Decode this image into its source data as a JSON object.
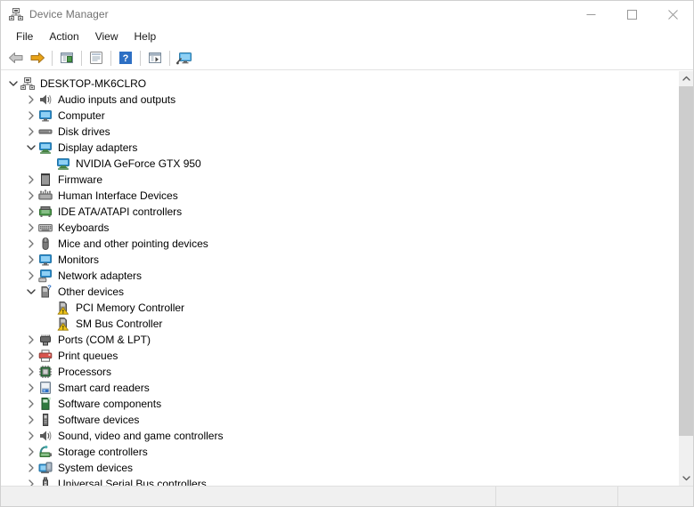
{
  "window": {
    "title": "Device Manager",
    "title_icon": "device-manager-icon",
    "controls": {
      "minimize": "Minimize",
      "maximize": "Maximize",
      "close": "Close"
    }
  },
  "menubar": {
    "items": [
      {
        "label": "File",
        "name": "menu-file"
      },
      {
        "label": "Action",
        "name": "menu-action"
      },
      {
        "label": "View",
        "name": "menu-view"
      },
      {
        "label": "Help",
        "name": "menu-help"
      }
    ]
  },
  "toolbar": {
    "buttons": [
      {
        "icon": "back-arrow-icon",
        "name": "toolbar-back"
      },
      {
        "icon": "forward-arrow-icon",
        "name": "toolbar-forward"
      },
      {
        "icon": "properties-icon",
        "name": "toolbar-properties"
      },
      {
        "icon": "update-driver-icon",
        "name": "toolbar-update-driver"
      },
      {
        "icon": "help-icon",
        "name": "toolbar-help"
      },
      {
        "icon": "scan-hardware-icon",
        "name": "toolbar-scan-hardware"
      },
      {
        "icon": "show-hidden-devices-icon",
        "name": "toolbar-show-hidden"
      }
    ]
  },
  "tree": {
    "nodes": [
      {
        "label": "DESKTOP-MK6CLRO",
        "depth": 0,
        "state": "expanded",
        "icon": "computer-node-icon"
      },
      {
        "label": "Audio inputs and outputs",
        "depth": 1,
        "state": "collapsed",
        "icon": "speaker-icon"
      },
      {
        "label": "Computer",
        "depth": 1,
        "state": "collapsed",
        "icon": "monitor-icon"
      },
      {
        "label": "Disk drives",
        "depth": 1,
        "state": "collapsed",
        "icon": "disk-drive-icon"
      },
      {
        "label": "Display adapters",
        "depth": 1,
        "state": "expanded",
        "icon": "display-adapter-icon"
      },
      {
        "label": "NVIDIA GeForce GTX 950",
        "depth": 2,
        "state": "leaf",
        "icon": "display-adapter-icon"
      },
      {
        "label": "Firmware",
        "depth": 1,
        "state": "collapsed",
        "icon": "firmware-icon"
      },
      {
        "label": "Human Interface Devices",
        "depth": 1,
        "state": "collapsed",
        "icon": "hid-icon"
      },
      {
        "label": "IDE ATA/ATAPI controllers",
        "depth": 1,
        "state": "collapsed",
        "icon": "ide-controller-icon"
      },
      {
        "label": "Keyboards",
        "depth": 1,
        "state": "collapsed",
        "icon": "keyboard-icon"
      },
      {
        "label": "Mice and other pointing devices",
        "depth": 1,
        "state": "collapsed",
        "icon": "mouse-icon"
      },
      {
        "label": "Monitors",
        "depth": 1,
        "state": "collapsed",
        "icon": "monitor-icon"
      },
      {
        "label": "Network adapters",
        "depth": 1,
        "state": "collapsed",
        "icon": "network-adapter-icon"
      },
      {
        "label": "Other devices",
        "depth": 1,
        "state": "expanded",
        "icon": "unknown-device-icon"
      },
      {
        "label": "PCI Memory Controller",
        "depth": 2,
        "state": "leaf",
        "icon": "unknown-device-warning-icon"
      },
      {
        "label": "SM Bus Controller",
        "depth": 2,
        "state": "leaf",
        "icon": "unknown-device-warning-icon"
      },
      {
        "label": "Ports (COM & LPT)",
        "depth": 1,
        "state": "collapsed",
        "icon": "port-icon"
      },
      {
        "label": "Print queues",
        "depth": 1,
        "state": "collapsed",
        "icon": "printer-icon"
      },
      {
        "label": "Processors",
        "depth": 1,
        "state": "collapsed",
        "icon": "processor-icon"
      },
      {
        "label": "Smart card readers",
        "depth": 1,
        "state": "collapsed",
        "icon": "smartcard-reader-icon"
      },
      {
        "label": "Software components",
        "depth": 1,
        "state": "collapsed",
        "icon": "software-component-icon"
      },
      {
        "label": "Software devices",
        "depth": 1,
        "state": "collapsed",
        "icon": "software-device-icon"
      },
      {
        "label": "Sound, video and game controllers",
        "depth": 1,
        "state": "collapsed",
        "icon": "speaker-icon"
      },
      {
        "label": "Storage controllers",
        "depth": 1,
        "state": "collapsed",
        "icon": "storage-controller-icon"
      },
      {
        "label": "System devices",
        "depth": 1,
        "state": "collapsed",
        "icon": "system-device-icon"
      },
      {
        "label": "Universal Serial Bus controllers",
        "depth": 1,
        "state": "collapsed",
        "icon": "usb-controller-icon"
      }
    ]
  },
  "scrollbar": {
    "up_arrow": "scroll-up-icon",
    "down_arrow": "scroll-down-icon"
  },
  "statusbar": {
    "main": "",
    "secondary": "",
    "tertiary": ""
  },
  "colors": {
    "accent_blue": "#2d8ccc",
    "icon_gray": "#6d6d6d",
    "warning_yellow": "#f0c419",
    "text": "#000000",
    "title_text": "#707070",
    "chrome": "#f0f0f0"
  }
}
